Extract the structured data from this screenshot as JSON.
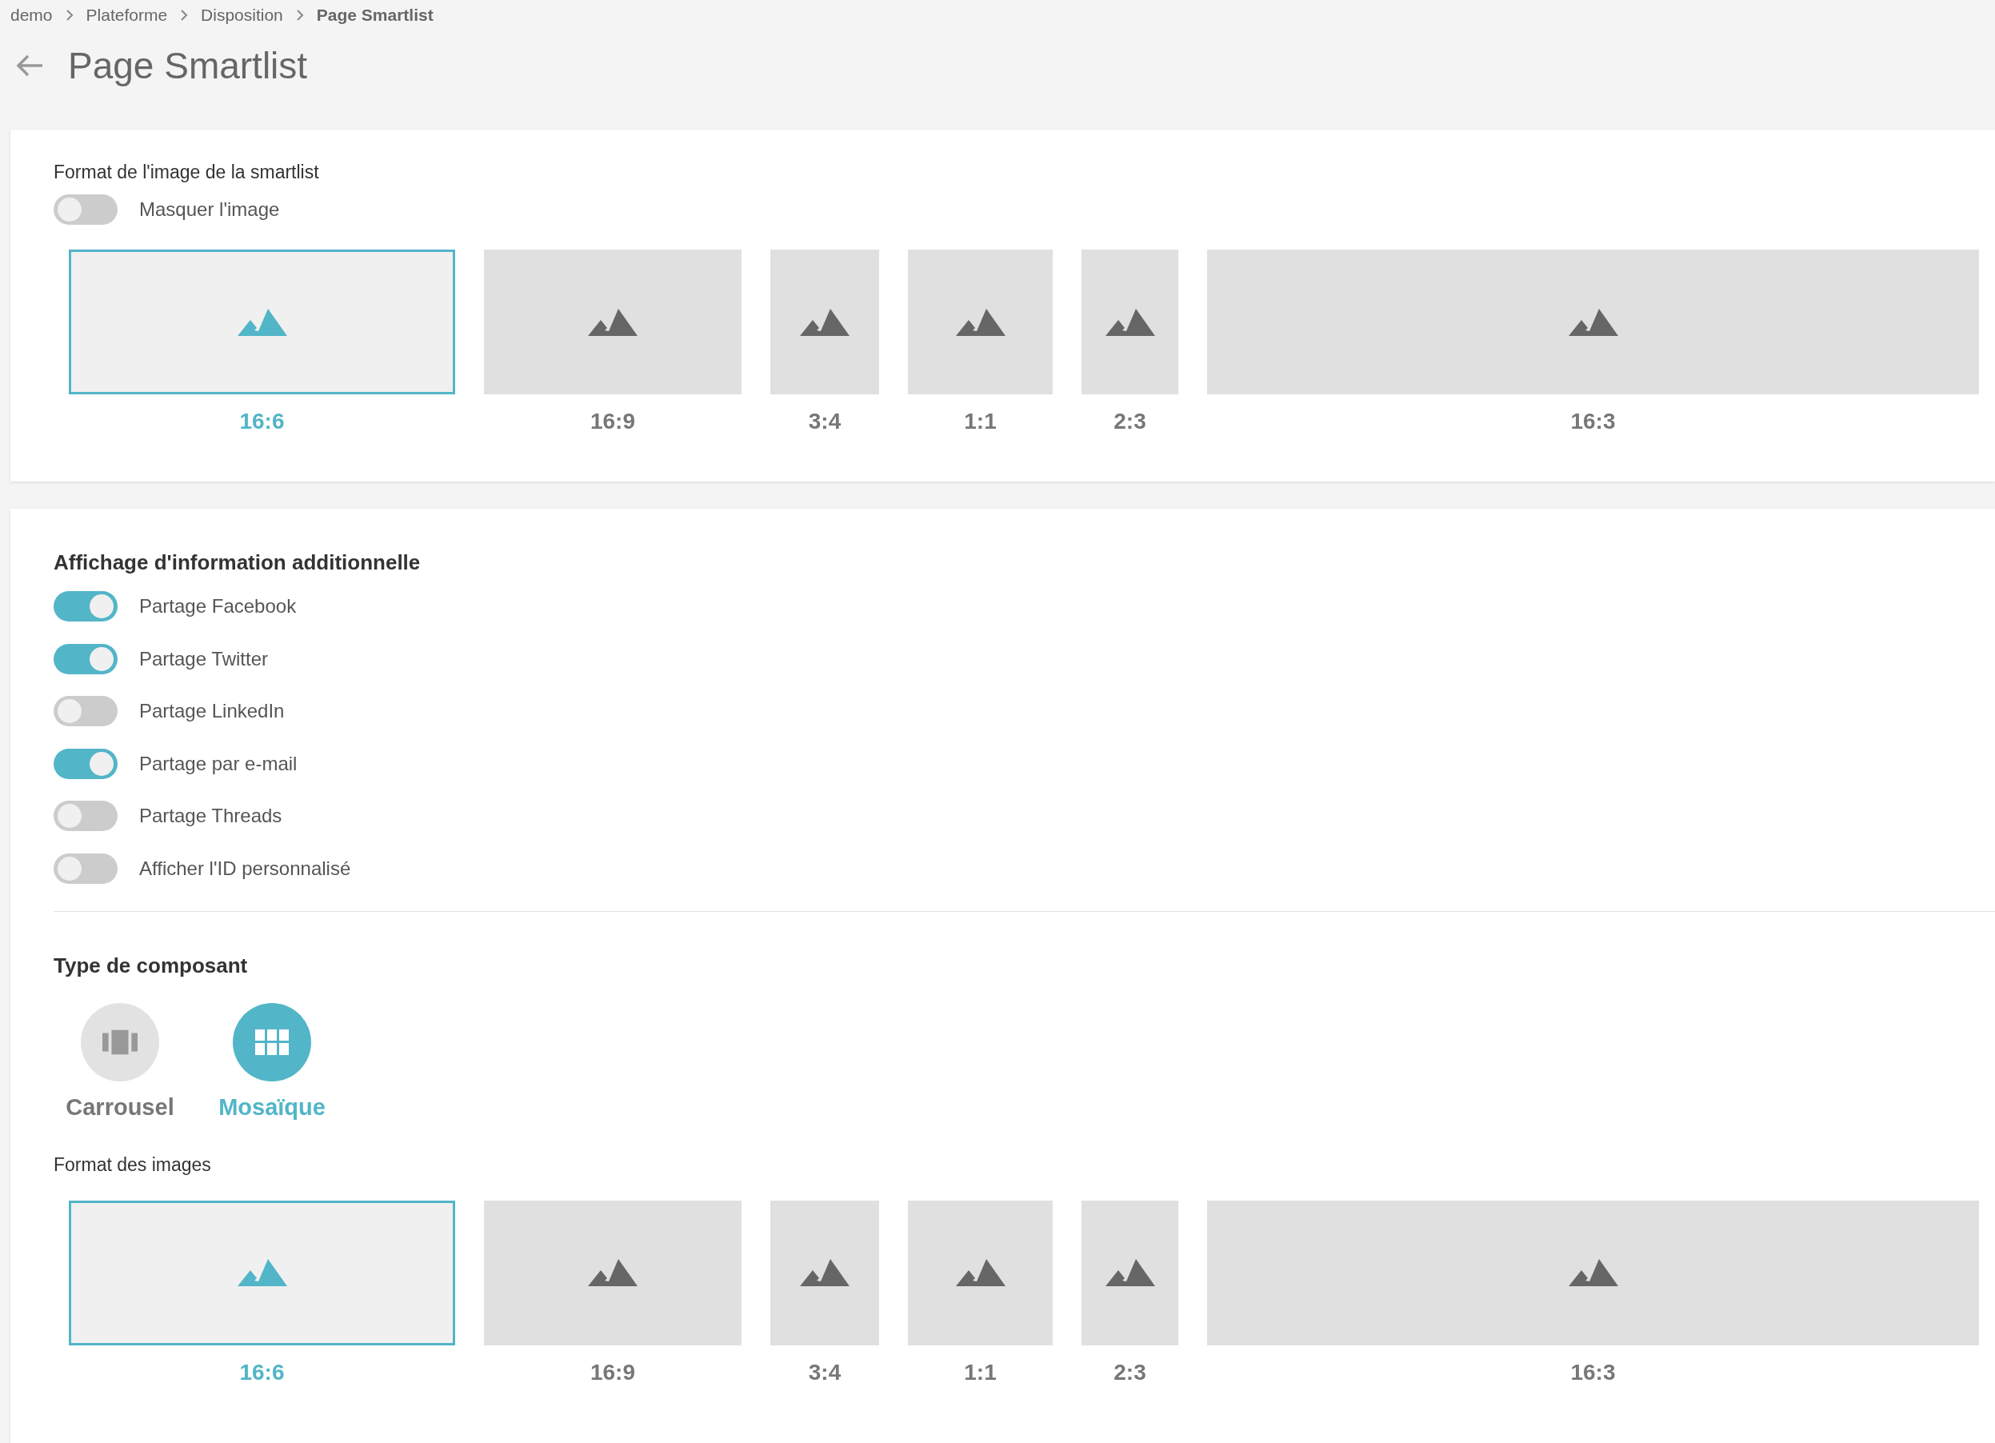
{
  "breadcrumb": [
    {
      "label": "demo",
      "current": false
    },
    {
      "label": "Plateforme",
      "current": false
    },
    {
      "label": "Disposition",
      "current": false
    },
    {
      "label": "Page Smartlist",
      "current": true
    }
  ],
  "page_title": "Page Smartlist",
  "image_format": {
    "label": "Format de l'image de la smartlist",
    "hide_toggle": {
      "label": "Masquer l'image",
      "on": false
    },
    "formats": [
      {
        "label": "16:6",
        "selected": true
      },
      {
        "label": "16:9",
        "selected": false
      },
      {
        "label": "3:4",
        "selected": false
      },
      {
        "label": "1:1",
        "selected": false
      },
      {
        "label": "2:3",
        "selected": false
      },
      {
        "label": "16:3",
        "selected": false
      }
    ]
  },
  "additional_info": {
    "heading": "Affichage d'information additionnelle",
    "toggles": [
      {
        "label": "Partage Facebook",
        "on": true
      },
      {
        "label": "Partage Twitter",
        "on": true
      },
      {
        "label": "Partage LinkedIn",
        "on": false
      },
      {
        "label": "Partage par e-mail",
        "on": true
      },
      {
        "label": "Partage Threads",
        "on": false
      },
      {
        "label": "Afficher l'ID personnalisé",
        "on": false
      }
    ]
  },
  "component_type": {
    "heading": "Type de composant",
    "options": [
      {
        "kind": "carousel",
        "label": "Carrousel",
        "selected": false
      },
      {
        "kind": "mosaic",
        "label": "Mosaïque",
        "selected": true
      }
    ]
  },
  "images_format": {
    "label": "Format des images",
    "formats": [
      {
        "label": "16:6",
        "selected": true
      },
      {
        "label": "16:9",
        "selected": false
      },
      {
        "label": "3:4",
        "selected": false
      },
      {
        "label": "1:1",
        "selected": false
      },
      {
        "label": "2:3",
        "selected": false
      },
      {
        "label": "16:3",
        "selected": false
      }
    ]
  }
}
